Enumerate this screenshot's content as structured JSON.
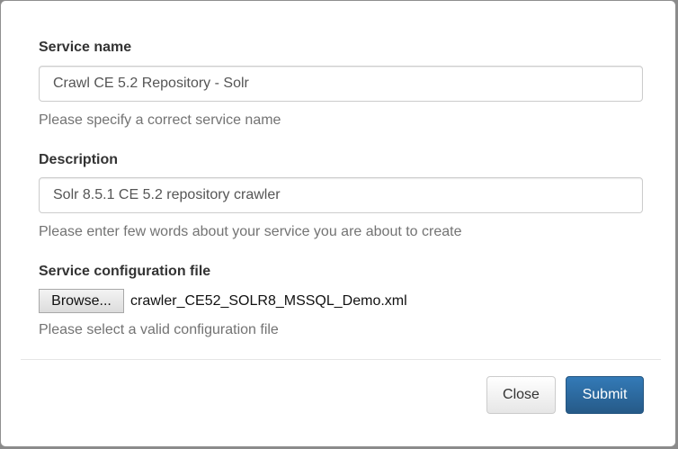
{
  "form": {
    "service_name": {
      "label": "Service name",
      "value": "Crawl CE 5.2 Repository - Solr",
      "help": "Please specify a correct service name"
    },
    "description": {
      "label": "Description",
      "value": "Solr 8.5.1 CE 5.2 repository crawler",
      "help": "Please enter few words about your service you are about to create"
    },
    "config_file": {
      "label": "Service configuration file",
      "browse_label": "Browse...",
      "file_name": "crawler_CE52_SOLR8_MSSQL_Demo.xml",
      "help": "Please select a valid configuration file"
    }
  },
  "footer": {
    "close_label": "Close",
    "submit_label": "Submit"
  },
  "colors": {
    "primary": "#337ab7",
    "help_text": "#737373",
    "label_text": "#333333"
  }
}
